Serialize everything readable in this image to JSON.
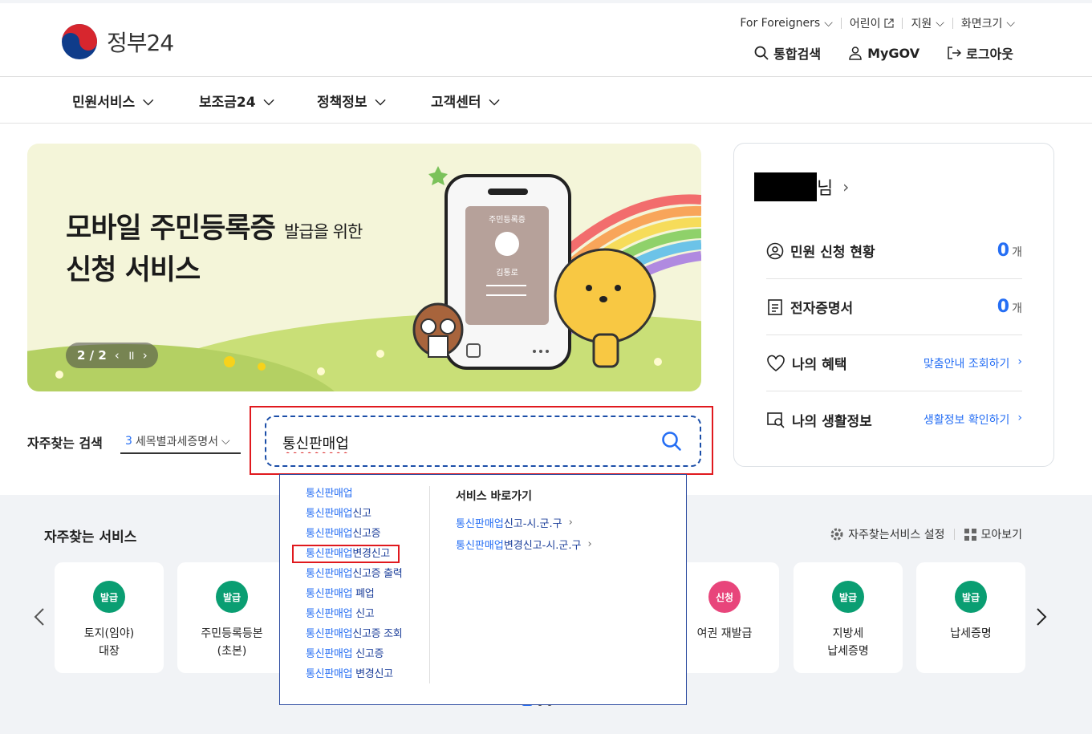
{
  "header": {
    "logo_text": "정부24",
    "util": [
      "For Foreigners",
      "어린이",
      "지원",
      "화면크기"
    ],
    "gnb": {
      "search": "통합검색",
      "mygov": "MyGOV",
      "logout": "로그아웃"
    }
  },
  "nav": [
    "민원서비스",
    "보조금24",
    "정책정보",
    "고객센터"
  ],
  "banner": {
    "line1_big": "모바일 주민등록증",
    "line1_small": "발급을 위한",
    "line2": "신청 서비스",
    "phone_label": "주민등록증",
    "phone_name": "김통로",
    "counter": "2 / 2"
  },
  "panel": {
    "name_suffix": "님",
    "rows": [
      {
        "label": "민원 신청 현황",
        "count": "0",
        "unit": "개"
      },
      {
        "label": "전자증명서",
        "count": "0",
        "unit": "개"
      },
      {
        "label": "나의 혜택",
        "link": "맞춤안내 조회하기"
      },
      {
        "label": "나의 생활정보",
        "link": "생활정보 확인하기"
      }
    ]
  },
  "frequent_search": {
    "label": "자주찾는 검색",
    "num": "3",
    "text": "세목별과세증명서"
  },
  "search": {
    "value": "통신판매업"
  },
  "autocomplete": {
    "items": [
      {
        "b": "통신판매업",
        "r": ""
      },
      {
        "b": "통신판매업",
        "r": "신고"
      },
      {
        "b": "통신판매업",
        "r": "신고증"
      },
      {
        "b": "통신판매업",
        "r": "변경신고"
      },
      {
        "b": "통신판매업",
        "r": "신고증 출력"
      },
      {
        "b": "통신판매업",
        "r": " 폐업"
      },
      {
        "b": "통신판매업",
        "r": " 신고"
      },
      {
        "b": "통신판매업",
        "r": "신고증 조회"
      },
      {
        "b": "통신판매업",
        "r": " 신고증"
      },
      {
        "b": "통신판매업",
        "r": " 변경신고"
      }
    ],
    "shortcut_title": "서비스 바로가기",
    "shortcuts": [
      {
        "b": "통신판매업",
        "r": "신고-시.군.구"
      },
      {
        "b": "통신판매업",
        "r": "변경신고-시.군.구"
      }
    ]
  },
  "frequent_services": {
    "title": "자주찾는 서비스",
    "settings": "자주찾는서비스 설정",
    "view_all": "모아보기",
    "cards": [
      {
        "badge": "발급",
        "l1": "토지(임야)",
        "l2": "대장",
        "color": "#0a9e72"
      },
      {
        "badge": "발급",
        "l1": "주민등록등본",
        "l2": "(초본)",
        "color": "#0a9e72"
      },
      {
        "badge": "신청",
        "l1": "여권 재발급",
        "l2": "",
        "color": "#e8457b"
      },
      {
        "badge": "발급",
        "l1": "지방세",
        "l2": "납세증명",
        "color": "#0a9e72"
      },
      {
        "badge": "발급",
        "l1": "납세증명",
        "l2": "",
        "color": "#0a9e72"
      }
    ]
  },
  "colors": {
    "accent": "#256ef4",
    "highlight": "#e0191e",
    "green": "#0a9e72",
    "pink": "#e8457b"
  }
}
